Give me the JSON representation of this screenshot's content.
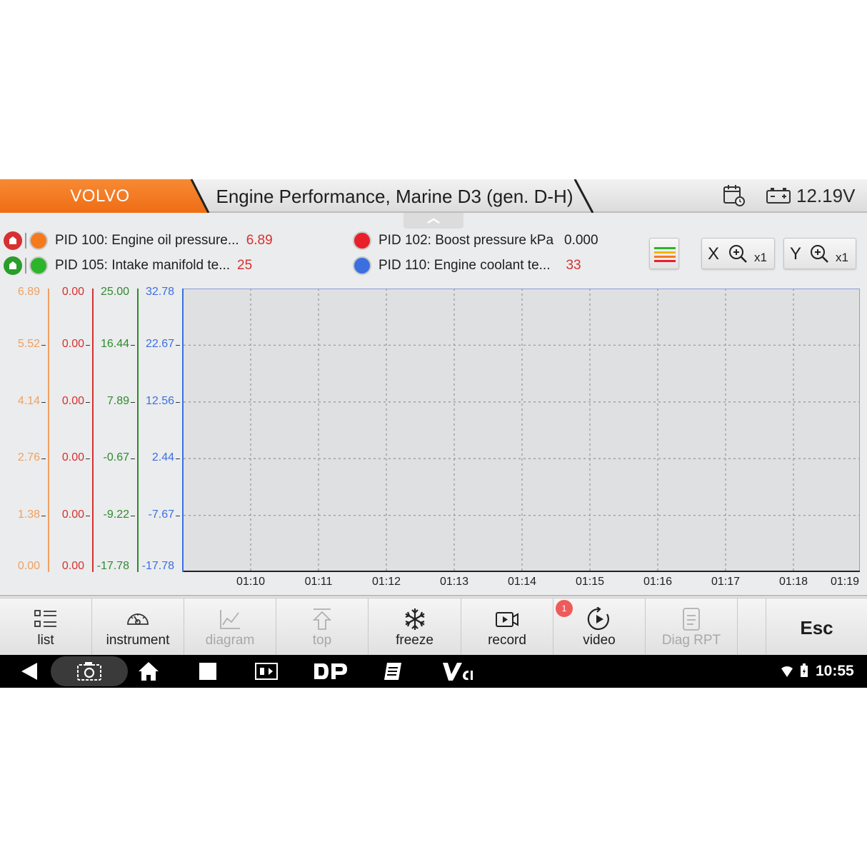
{
  "header": {
    "brand": "VOLVO",
    "title": "Engine Performance, Marine D3 (gen. D-H)",
    "voltage": "12.19V",
    "brand_color": "#f47a20"
  },
  "legend": [
    {
      "label": "PID 100: Engine oil pressure...",
      "value": "6.89",
      "color": "#f47a20",
      "flag": "red"
    },
    {
      "label": "PID 105: Intake manifold te...",
      "value": "25",
      "color": "#2ab52a",
      "flag": "green"
    },
    {
      "label": "PID 102: Boost pressure  kPa",
      "value": "0.000",
      "color": "#e8202a"
    },
    {
      "label": "PID 110: Engine coolant te...",
      "value": "33",
      "color": "#3b6fe0"
    }
  ],
  "tools": {
    "x_zoom_letter": "X",
    "x_zoom_level": "x1",
    "y_zoom_letter": "Y",
    "y_zoom_level": "x1"
  },
  "chart_data": {
    "type": "line",
    "x": [
      "01:10",
      "01:11",
      "01:12",
      "01:13",
      "01:14",
      "01:15",
      "01:16",
      "01:17",
      "01:18",
      "01:19"
    ],
    "y_axes": [
      {
        "color": "#f0a060",
        "ticks": [
          "6.89",
          "5.52",
          "4.14",
          "2.76",
          "1.38",
          "0.00"
        ]
      },
      {
        "color": "#d63031",
        "ticks": [
          "0.00",
          "0.00",
          "0.00",
          "0.00",
          "0.00",
          "0.00"
        ]
      },
      {
        "color": "#2e8b2e",
        "ticks": [
          "25.00",
          "16.44",
          "7.89",
          "-0.67",
          "-9.22",
          "-17.78"
        ]
      },
      {
        "color": "#3b6fe0",
        "ticks": [
          "32.78",
          "22.67",
          "12.56",
          "2.44",
          "-7.67",
          "-17.78"
        ]
      }
    ],
    "grid": true,
    "series": []
  },
  "toolbar": {
    "buttons": [
      {
        "label": "list",
        "icon": "list-icon",
        "enabled": true
      },
      {
        "label": "instrument",
        "icon": "gauge-icon",
        "enabled": true
      },
      {
        "label": "diagram",
        "icon": "line-chart-icon",
        "enabled": false
      },
      {
        "label": "top",
        "icon": "arrow-up-icon",
        "enabled": false
      },
      {
        "label": "freeze",
        "icon": "snowflake-icon",
        "enabled": true
      },
      {
        "label": "record",
        "icon": "camera-icon",
        "enabled": true
      },
      {
        "label": "video",
        "icon": "play-icon",
        "enabled": true
      },
      {
        "label": "Diag RPT",
        "icon": "report-icon",
        "enabled": false
      }
    ],
    "esc_label": "Esc",
    "video_badge": "1"
  },
  "statusbar": {
    "time": "10:55"
  }
}
